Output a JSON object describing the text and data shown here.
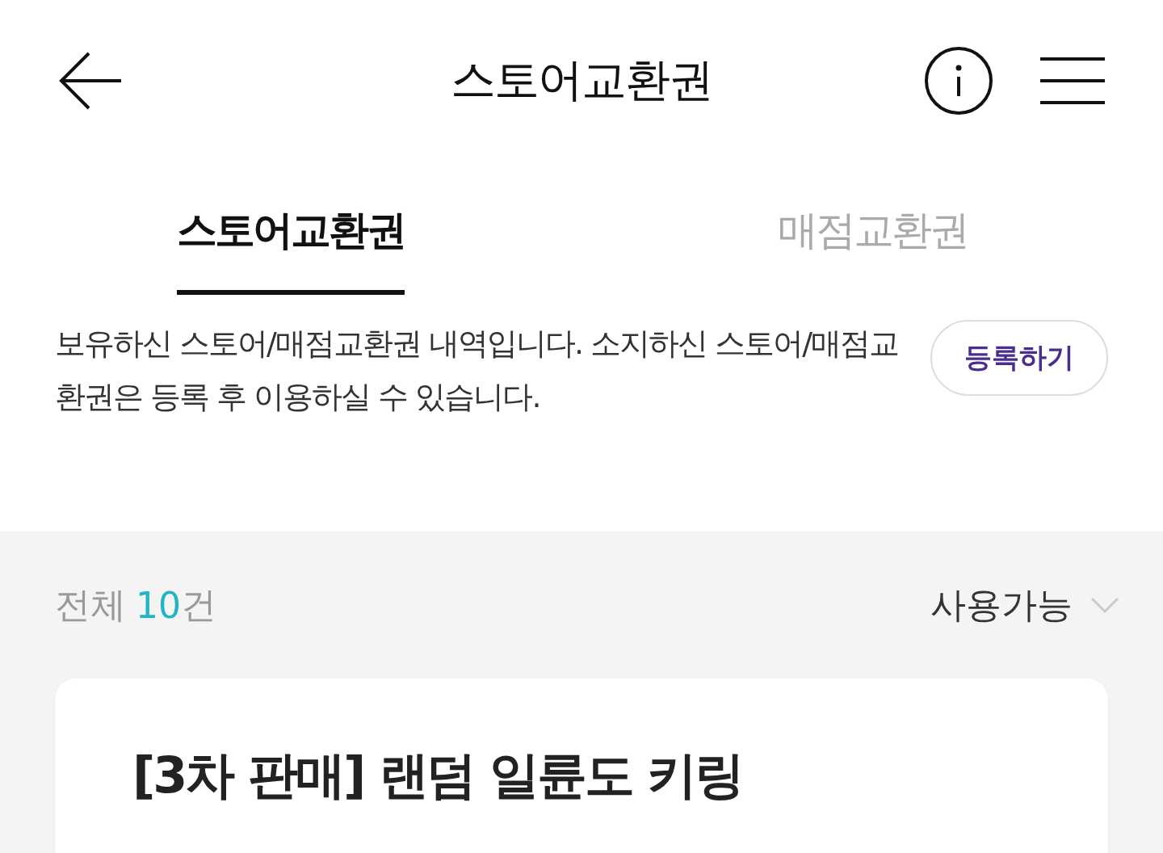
{
  "header": {
    "title": "스토어교환권"
  },
  "tabs": [
    {
      "label": "스토어교환권",
      "selected": true
    },
    {
      "label": "매점교환권",
      "selected": false
    }
  ],
  "notice": {
    "text": "보유하신 스토어/매점교환권 내역입니다. 소지하신 스토어/매점교환권은 등록 후 이용하실 수 있습니다.",
    "button": "등록하기"
  },
  "summary": {
    "label": "전체",
    "count": "10",
    "unit": "건",
    "filter": "사용가능"
  },
  "cards": [
    {
      "title": "[3차 판매] 랜덤 일륜도 키링"
    }
  ]
}
